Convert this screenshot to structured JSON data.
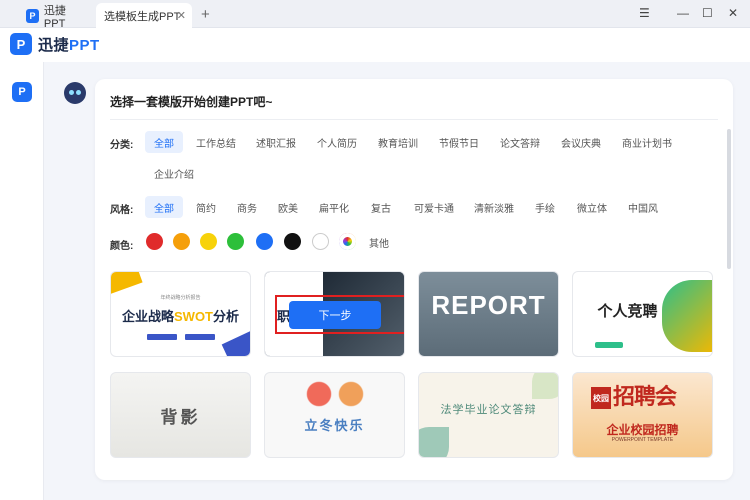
{
  "window": {
    "tabs": [
      {
        "label": "迅捷PPT",
        "active": false
      },
      {
        "label": "选模板生成PPT",
        "active": true
      }
    ],
    "new_tab": "+",
    "controls": {
      "menu": "☰",
      "minimize": "—",
      "maximize": "☐",
      "close": "✕"
    }
  },
  "brand": {
    "logo_letter": "P",
    "name_cn": "迅捷",
    "name_en": "PPT"
  },
  "card": {
    "title": "选择一套模版开始创建PPT吧~",
    "category": {
      "label": "分类:",
      "items": [
        "全部",
        "工作总结",
        "述职汇报",
        "个人简历",
        "教育培训",
        "节假节日",
        "论文答辩",
        "会议庆典",
        "商业计划书",
        "企业介绍"
      ],
      "selected": "全部"
    },
    "style": {
      "label": "风格:",
      "items": [
        "全部",
        "简约",
        "商务",
        "欧美",
        "扁平化",
        "复古",
        "可爱卡通",
        "清新淡雅",
        "手绘",
        "微立体",
        "中国风"
      ],
      "selected": "全部"
    },
    "color": {
      "label": "颜色:",
      "swatches": [
        "#e02b2b",
        "#f59f0a",
        "#f7d20a",
        "#2dbf3a",
        "#1e6ff5",
        "#111111",
        "#ffffff",
        "rainbow"
      ],
      "other_label": "其他"
    },
    "templates": {
      "t1": {
        "subtitle": "年终战略分析报告",
        "title_a": "企业战略",
        "title_b": "SWOT",
        "title_c": "分析"
      },
      "t2": {
        "letter": "职",
        "next_button": "下一步"
      },
      "t3": {
        "title": "REPORT"
      },
      "t4": {
        "title": "个人竞聘"
      },
      "t5": {
        "title": "背影"
      },
      "t6": {
        "title": "立冬快乐"
      },
      "t7": {
        "title": "法学毕业论文答辩"
      },
      "t8": {
        "stamp": "校园",
        "big": "招聘会",
        "title": "企业校园招聘",
        "subtitle": "POWERPOINT TEMPLATE"
      }
    }
  }
}
